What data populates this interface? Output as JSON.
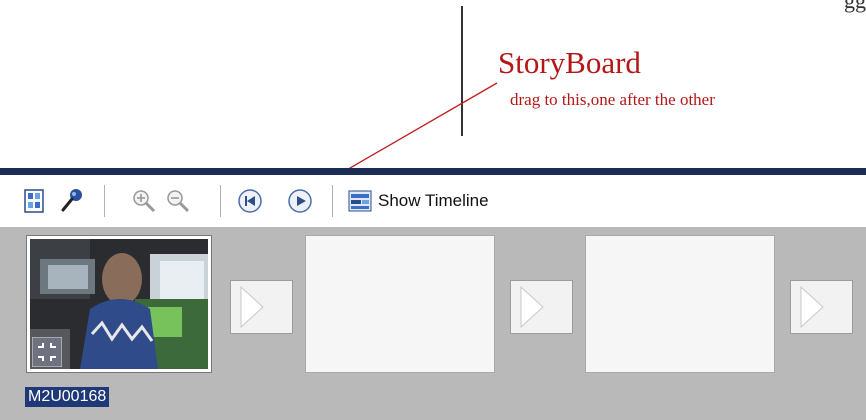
{
  "annotation": {
    "partial_text": "gg",
    "title": "StoryBoard",
    "subtitle": "drag to this,one after the other"
  },
  "toolbar": {
    "buttons": [
      "storyboard-icon",
      "narrate-icon",
      "zoom-in-icon",
      "zoom-out-icon",
      "rewind-icon",
      "play-icon",
      "timeline-icon"
    ],
    "show_timeline_label": "Show Timeline"
  },
  "storyboard": {
    "clip_name": "M2U00168",
    "empty_slots": 2,
    "transition_slots": 3
  },
  "colors": {
    "annotation": "#b51616",
    "panel_bg": "#b9b9b9",
    "top_bar": "#1b2d55",
    "selection": "#1f3878"
  }
}
